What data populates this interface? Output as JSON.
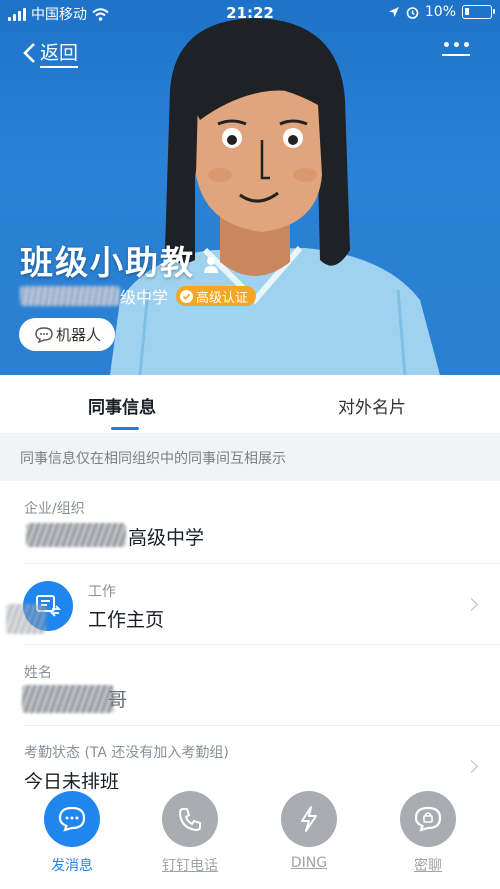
{
  "status_bar": {
    "carrier": "中国移动",
    "time": "21:22",
    "battery": "10%"
  },
  "header": {
    "back_label": "返回",
    "more_icon": "more-dots-icon"
  },
  "profile": {
    "name": "班级小助教",
    "org_suffix": "级中学",
    "certification": "高级认证",
    "tag": "机器人"
  },
  "tabs": [
    {
      "label": "同事信息",
      "active": true
    },
    {
      "label": "对外名片",
      "active": false
    }
  ],
  "notice": "同事信息仅在相同组织中的同事间互相展示",
  "info": {
    "org": {
      "label": "企业/组织",
      "value": "高级中学"
    },
    "work": {
      "label": "工作",
      "value": "工作主页"
    },
    "name": {
      "label": "姓名",
      "value": "哥"
    },
    "attendance": {
      "label": "考勤状态 (TA 还没有加入考勤组)",
      "value": "今日未排班"
    }
  },
  "actions": [
    {
      "label": "发消息",
      "icon": "message-icon"
    },
    {
      "label": "钉钉电话",
      "icon": "phone-icon"
    },
    {
      "label": "DING",
      "icon": "lightning-icon"
    },
    {
      "label": "密聊",
      "icon": "secret-chat-icon"
    }
  ],
  "colors": {
    "accent": "#1f86f0",
    "badge": "#f5a623",
    "hero_bg": "#2a82d6"
  }
}
